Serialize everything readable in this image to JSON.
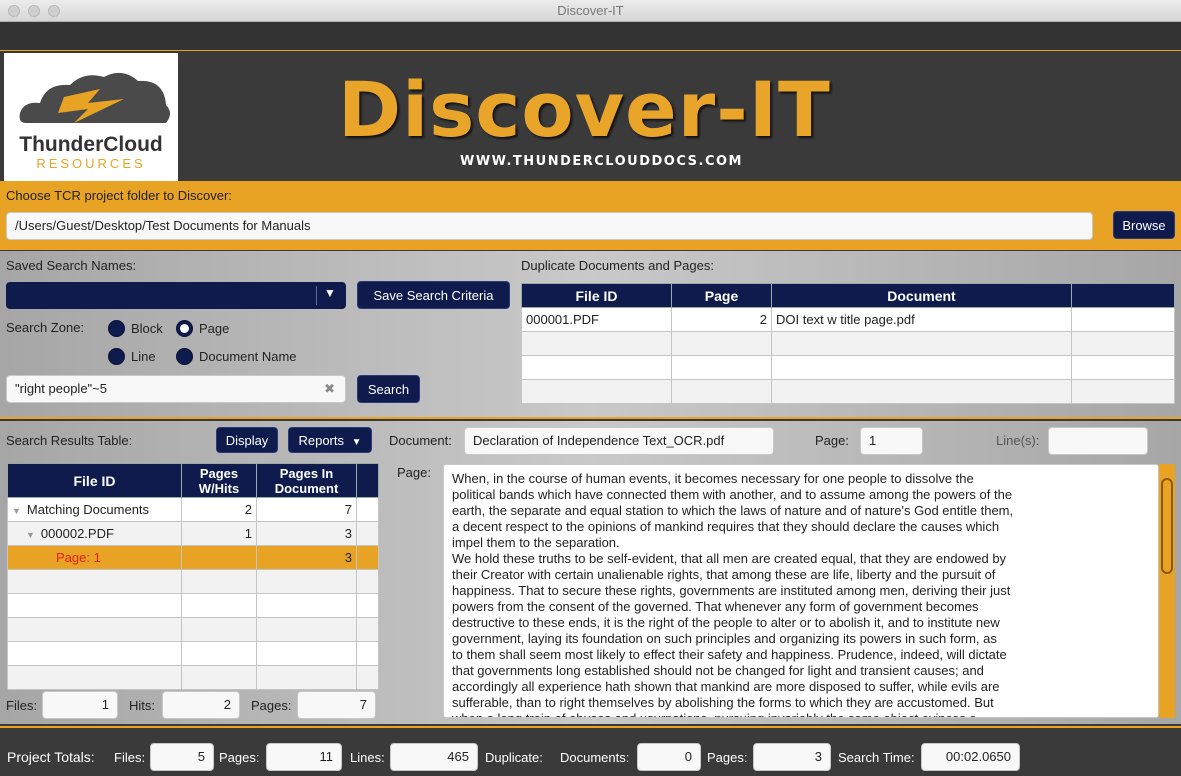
{
  "window": {
    "title": "Discover-IT"
  },
  "banner": {
    "logo_brand": "ThunderCloud",
    "logo_sub": "RESOURCES",
    "title": "Discover-IT",
    "url": "WWW.THUNDERCLOUDDOCS.COM"
  },
  "folder": {
    "label": "Choose TCR project folder to Discover:",
    "path": "/Users/Guest/Desktop/Test Documents for Manuals",
    "browse_label": "Browse"
  },
  "search": {
    "saved_label": "Saved Search Names:",
    "saved_value": "",
    "save_criteria_label": "Save Search Criteria",
    "zone_label": "Search Zone:",
    "zones": {
      "block": "Block",
      "page": "Page",
      "line": "Line",
      "document_name": "Document Name"
    },
    "selected_zone": "Page",
    "query": "\"right people\"~5",
    "search_label": "Search"
  },
  "duplicates": {
    "label": "Duplicate Documents and Pages:",
    "columns": [
      "File ID",
      "Page",
      "Document",
      ""
    ],
    "rows": [
      {
        "file_id": "000001.PDF",
        "page": "2",
        "document": "DOI text w title page.pdf"
      }
    ]
  },
  "results": {
    "label": "Search Results Table:",
    "display_label": "Display",
    "reports_label": "Reports",
    "columns": {
      "file_id": "File ID",
      "pages_hits": "Pages W/Hits",
      "pages_doc": "Pages In Document"
    },
    "rows": [
      {
        "name": "Matching Documents",
        "hits": "2",
        "pages": "7"
      },
      {
        "name": "000002.PDF",
        "hits": "1",
        "pages": "3"
      },
      {
        "name": "Page: 1",
        "hits": "",
        "pages": "3"
      }
    ],
    "files_label": "Files:",
    "files": "1",
    "hits_label": "Hits:",
    "hits": "2",
    "pages_label": "Pages:",
    "pages": "7"
  },
  "document": {
    "label": "Document:",
    "name": "Declaration of Independence Text_OCR.pdf",
    "page_label": "Page:",
    "page": "1",
    "lines_label": "Line(s):",
    "lines": "",
    "page_text_label": "Page:",
    "page_text": [
      "When, in the course of human events, it becomes necessary for one people to dissolve the",
      "political bands which have connected them with another, and to assume among the powers of the",
      "earth, the separate and equal station to which the laws of nature and of nature's God entitle them,",
      "a decent respect to the opinions of mankind requires that they should declare the causes which",
      "impel them to the separation.",
      "We hold these truths to be self-evident, that all men are created equal, that they are endowed by",
      "their Creator with certain unalienable rights, that among these are life, liberty and the pursuit of",
      "happiness. That to secure these rights, governments are instituted among men, deriving their just",
      "powers from the consent of the governed. That whenever any form of government becomes",
      "destructive to these ends, it is the right of the people to alter or to abolish it, and to institute new",
      "government, laying its foundation on such principles and organizing its powers in such form, as",
      "to them shall seem most likely to effect their safety and happiness. Prudence, indeed, will dictate",
      "that governments long established should not be changed for light and transient causes; and",
      "accordingly all experience hath shown that mankind are more disposed to suffer, while evils are",
      "sufferable, than to right themselves by abolishing the forms to which they are accustomed. But",
      "when a long train of abuses and usurpations, pursuing invariably the same object evinces a"
    ]
  },
  "totals": {
    "label": "Project Totals:",
    "files_label": "Files:",
    "files": "5",
    "pages_label": "Pages:",
    "pages": "11",
    "lines_label": "Lines:",
    "lines": "465",
    "duplicate_label": "Duplicate:",
    "documents_label": "Documents:",
    "documents": "0",
    "dup_pages_label": "Pages:",
    "dup_pages": "3",
    "search_time_label": "Search Time:",
    "search_time": "00:02.0650"
  },
  "colors": {
    "accent": "#e8a325",
    "navy": "#0f1b4d",
    "highlight_text": "#e0201a"
  }
}
